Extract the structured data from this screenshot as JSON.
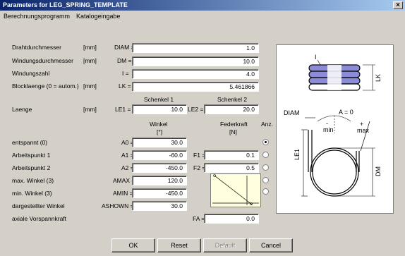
{
  "window": {
    "title": "Parameters for LEG_SPRING_TEMPLATE",
    "close_glyph": "×"
  },
  "menu": [
    "Berechnungsprogramm",
    "Katalogeingabe"
  ],
  "rows": [
    {
      "label": "Drahtdurchmesser",
      "unit": "[mm]",
      "code": "DIAM =",
      "value": "1.0"
    },
    {
      "label": "Windungsdurchmesser",
      "unit": "[mm]",
      "code": "DM =",
      "value": "10.0"
    },
    {
      "label": "Windungszahl",
      "unit": "",
      "code": "I =",
      "value": "4.0"
    },
    {
      "label": "Blocklaenge (0 = autom.)",
      "unit": "[mm]",
      "code": "LK =",
      "value": "5.461866"
    }
  ],
  "schenkel": {
    "h1": "Schenkel 1",
    "h2": "Schenkel 2",
    "label": "Laenge",
    "unit": "[mm]",
    "code1": "LE1 =",
    "value1": "10.0",
    "code2": "LE2 =",
    "value2": "20.0"
  },
  "headers": {
    "winkel": "Winkel",
    "winkel_unit": "[°]",
    "feder": "Federkraft",
    "feder_unit": "[N]",
    "anz": "Anz."
  },
  "angles": [
    {
      "label": "entspannt (0)",
      "code": "A0 =",
      "value": "30.0",
      "radio_checked": true
    },
    {
      "label": "Arbeitspunkt 1",
      "code": "A1 =",
      "value": "-60.0",
      "fcode": "F1 =",
      "fvalue": "0.1",
      "radio_checked": false
    },
    {
      "label": "Arbeitspunkt 2",
      "code": "A2 =",
      "value": "-450.0",
      "fcode": "F2 =",
      "fvalue": "0.5",
      "radio_checked": false
    },
    {
      "label": "max. Winkel (3)",
      "code": "AMAX =",
      "value": "120.0",
      "radio_checked": false
    },
    {
      "label": "min. Winkel (3)",
      "code": "AMIN =",
      "value": "-450.0",
      "radio_checked": false
    },
    {
      "label": "dargestellter Winkel",
      "code": "ASHOWN =",
      "value": "30.0"
    }
  ],
  "axial": {
    "label": "axiale Vorspannkraft",
    "code": "FA =",
    "value": "0.0"
  },
  "diagram": {
    "I": "I",
    "LK": "LK",
    "DIAM": "DIAM",
    "A0": "A = 0",
    "min": "min",
    "max": "max",
    "minus": "-",
    "plus": "+",
    "LE1": "LE1",
    "DM": "DM",
    "spring_color": "#8b8bd8"
  },
  "buttons": {
    "ok": "OK",
    "reset": "Reset",
    "default": "Default",
    "cancel": "Cancel"
  }
}
